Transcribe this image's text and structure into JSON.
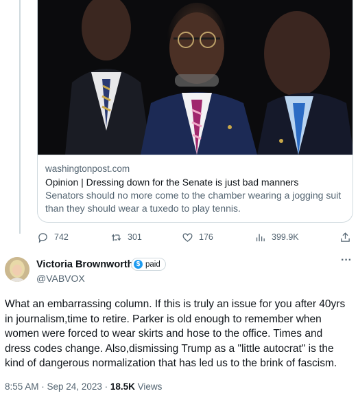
{
  "link_card": {
    "domain": "washingtonpost.com",
    "title": "Opinion | Dressing down for the Senate is just bad manners",
    "description_line1": "Senators should no more come to the chamber wearing a jogging suit",
    "description_line2": "than they should wear a tuxedo to play tennis."
  },
  "actions": {
    "replies": "742",
    "reposts": "301",
    "likes": "176",
    "views": "399.9K"
  },
  "author": {
    "display_name": "Victoria Brownworth",
    "badge_label": "paid",
    "handle": "@VABVOX"
  },
  "post": {
    "lines": [
      "What an embarrassing column.  If this is truly an issue for you after 40yrs",
      "in journalism,time to retire. Parker is old enough to remember when",
      "women were forced to wear skirts and hose to the office. Times and",
      "dress codes change. Also,dismissing Trump as a \"little autocrat\" is the",
      "kind of dangerous normalization that has led us to the brink of fascism."
    ]
  },
  "meta": {
    "timestamp": "8:55 AM · Sep 24, 2023 · ",
    "views_count": "18.5K",
    "views_label": " Views"
  },
  "colors": {
    "text_primary": "#0f1419",
    "text_secondary": "#536471",
    "border": "#cfd9de",
    "accent": "#1d9bf0"
  },
  "icons": {
    "reply": "speech-bubble-icon",
    "repost": "repost-arrows-icon",
    "like": "heart-icon",
    "views": "bar-chart-icon",
    "share": "share-upload-icon",
    "more": "more-dots-icon"
  }
}
